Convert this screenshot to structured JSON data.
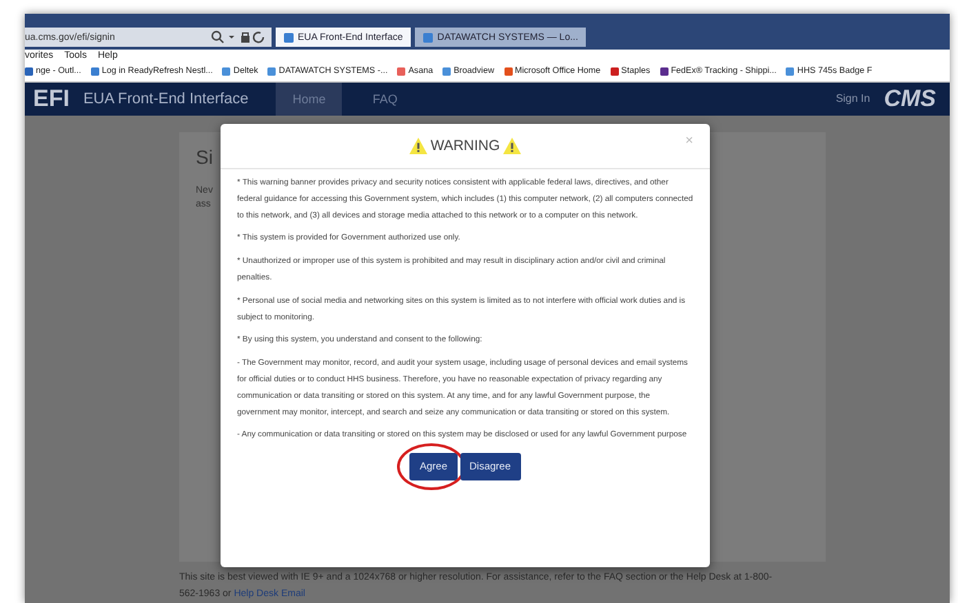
{
  "browser": {
    "address": "ua.cms.gov/efi/signin",
    "tabs": [
      {
        "label": "EUA Front-End Interface",
        "selected": true
      },
      {
        "label": "DATAWATCH SYSTEMS — Lo...",
        "selected": false
      }
    ],
    "menu": [
      "vorites",
      "Tools",
      "Help"
    ],
    "favorites": [
      {
        "label": "nge - Outl...",
        "color": "#2a64b8"
      },
      {
        "label": "Log in ReadyRefresh Nestl...",
        "color": "#3b7fd0"
      },
      {
        "label": "Deltek",
        "color": "#4a90d9"
      },
      {
        "label": "DATAWATCH SYSTEMS -...",
        "color": "#4a90d9"
      },
      {
        "label": "Asana",
        "color": "#e8605a"
      },
      {
        "label": "Broadview",
        "color": "#4a90d9"
      },
      {
        "label": "Microsoft Office Home",
        "color": "#e3501c"
      },
      {
        "label": "Staples",
        "color": "#cc1f1f"
      },
      {
        "label": "FedEx® Tracking - Shippi...",
        "color": "#5b2d8e"
      },
      {
        "label": "HHS 745s Badge F",
        "color": "#4a90d9"
      }
    ]
  },
  "app_header": {
    "logo": "EFI",
    "title": "EUA Front-End Interface",
    "nav": [
      {
        "label": "Home",
        "selected": true
      },
      {
        "label": "FAQ",
        "selected": false
      }
    ],
    "sign_in": "Sign In",
    "brand": "CMS"
  },
  "background_page": {
    "heading": "Si",
    "lines": [
      "Nev",
      "ass"
    ]
  },
  "modal": {
    "title": "WARNING",
    "close": "×",
    "paragraphs": [
      "* This warning banner provides privacy and security notices consistent with applicable federal laws, directives, and other federal guidance for accessing this Government system, which includes (1) this computer network, (2) all computers connected to this network, and (3) all devices and storage media attached to this network or to a computer on this network.",
      "* This system is provided for Government authorized use only.",
      "* Unauthorized or improper use of this system is prohibited and may result in disciplinary action and/or civil and criminal penalties.",
      "* Personal use of social media and networking sites on this system is limited as to not interfere with official work duties and is subject to monitoring.",
      "* By using this system, you understand and consent to the following:",
      "- The Government may monitor, record, and audit your system usage, including usage of personal devices and email systems for official duties or to conduct HHS business. Therefore, you have no reasonable expectation of privacy regarding any communication or data transiting or stored on this system. At any time, and for any lawful Government purpose, the government may monitor, intercept, and search and seize any communication or data transiting or stored on this system.",
      "- Any communication or data transiting or stored on this system may be disclosed or used for any lawful Government purpose"
    ],
    "buttons": [
      {
        "label": "Agree",
        "highlighted": true
      },
      {
        "label": "Disagree",
        "highlighted": false
      }
    ]
  },
  "footer": {
    "text": "This site is best viewed with IE 9+ and a 1024x768 or higher resolution. For assistance, refer to the FAQ section or the Help Desk at 1-800-562-1963 or",
    "link": "Help Desk Email"
  }
}
